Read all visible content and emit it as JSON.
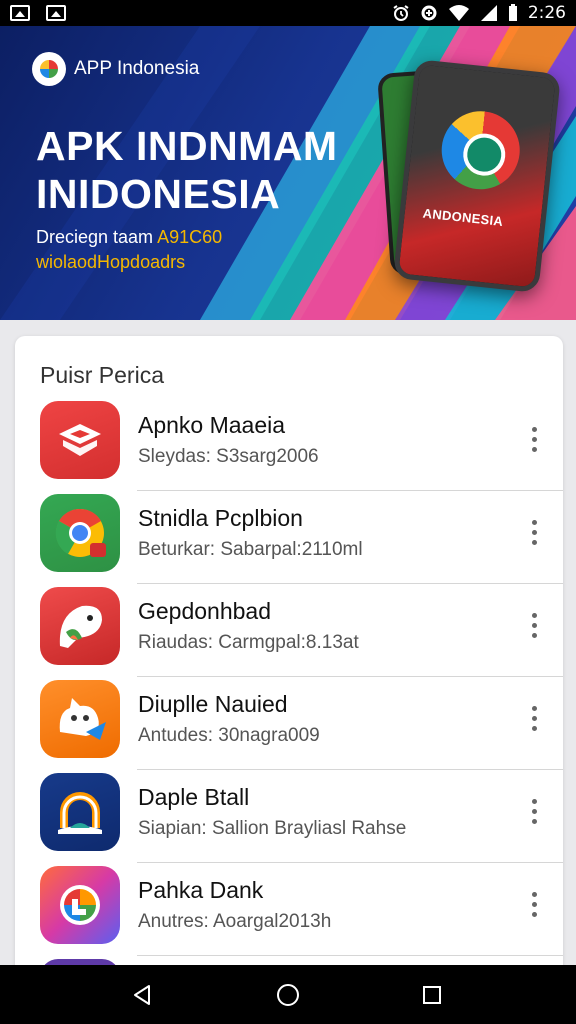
{
  "status_bar": {
    "time": "2:26",
    "left_icons": [
      "image-icon",
      "image-icon"
    ],
    "right_icons": [
      "alarm-icon",
      "data-saver-icon",
      "wifi-icon",
      "signal-icon",
      "battery-icon"
    ]
  },
  "banner": {
    "brand": "APP Indonesia",
    "headline_line1": "APK INDNMAM",
    "headline_line2": "INIDONESIA",
    "tagline_prefix": "Dreciegn taam ",
    "tagline_highlight": "A91C60",
    "tagline_line2": "wiolaodHopdoadrs",
    "phone_label": "ANDONESIA"
  },
  "section": {
    "title": "Puisr Perica"
  },
  "apps": [
    {
      "name": "Apnko Maaeia",
      "subtitle": "Sleydas: S3sarg2006",
      "icon": "red-box-icon",
      "color": "#e53935"
    },
    {
      "name": "Stnidla Pcplbion",
      "subtitle": "Beturkar: Sabarpal:2110ml",
      "icon": "chrome-icon",
      "color": "#34a853"
    },
    {
      "name": "Gepdonhbad",
      "subtitle": "Riaudas: Carmgpal:8.13at",
      "icon": "parrot-icon",
      "color": "#ef4b4b"
    },
    {
      "name": "Diuplle Nauied",
      "subtitle": "Antudes: 30nagra009",
      "icon": "cat-icon",
      "color": "#ff8f2b"
    },
    {
      "name": "Daple Btall",
      "subtitle": "Siapian: Sallion Brayliasl Rahse",
      "icon": "arch-icon",
      "color": "#173a8a"
    },
    {
      "name": "Pahka Dank",
      "subtitle": "Anutres: Aoargal2013h",
      "icon": "colorful-circle-icon",
      "color": "#d63aa6"
    }
  ],
  "nav_bar": {
    "buttons": [
      "back-icon",
      "home-icon",
      "recents-icon"
    ]
  }
}
